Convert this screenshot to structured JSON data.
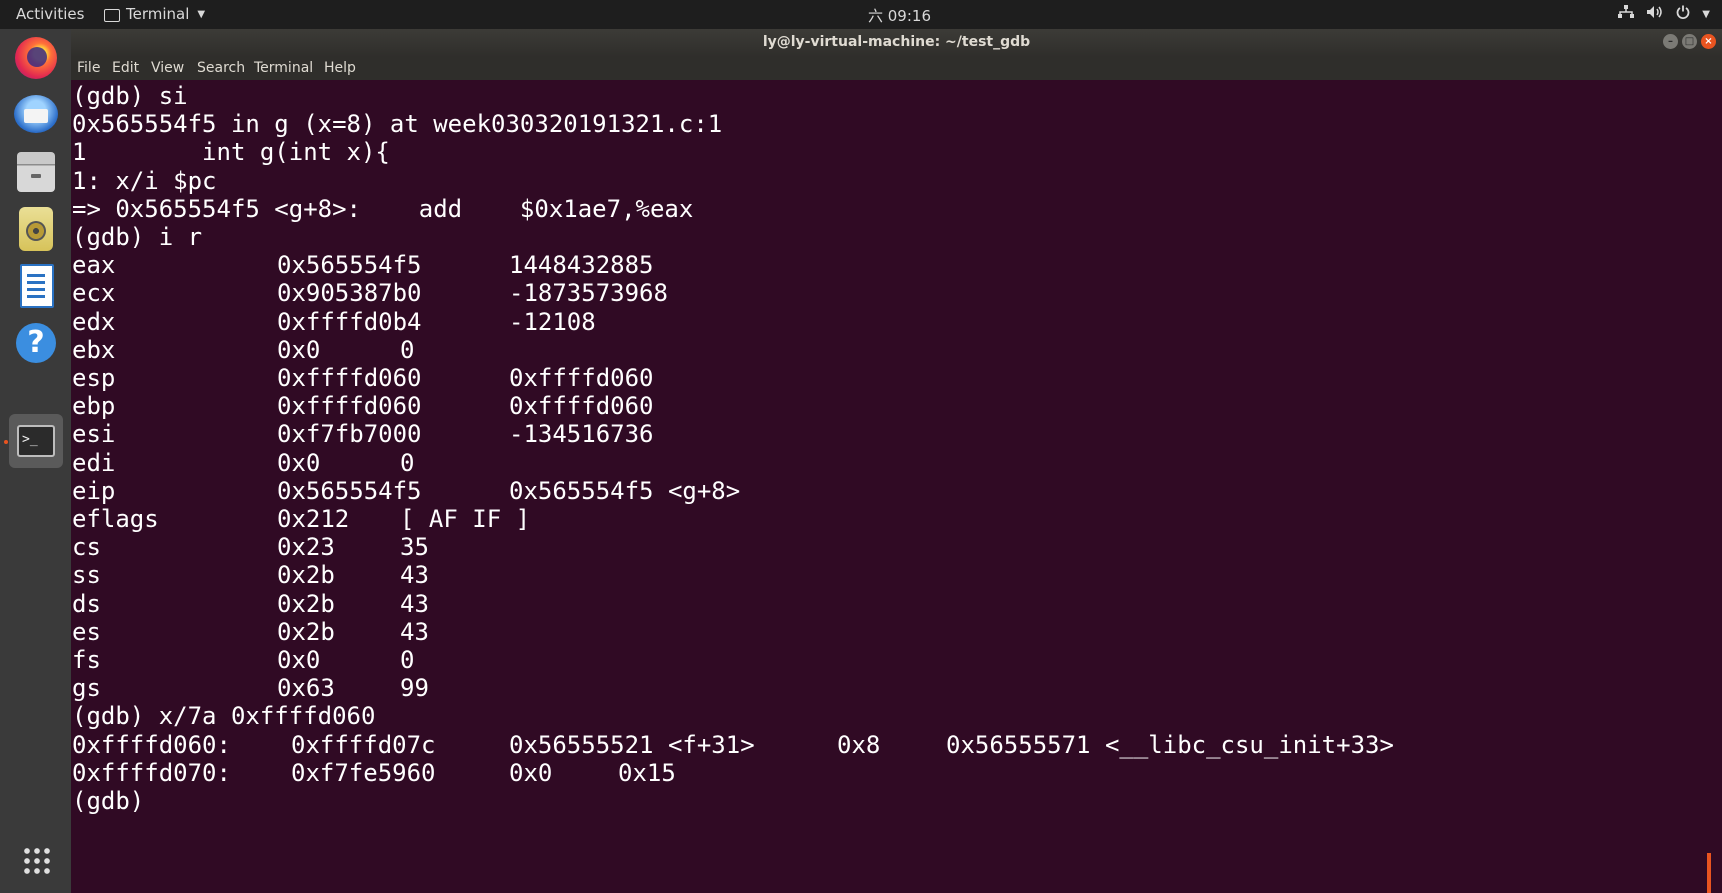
{
  "topbar": {
    "activities": "Activities",
    "app_name": "Terminal",
    "clock": "六 09:16"
  },
  "dock": {
    "items": [
      {
        "name": "firefox-icon"
      },
      {
        "name": "thunderbird-mail-icon"
      },
      {
        "name": "files-icon"
      },
      {
        "name": "rhythmbox-icon"
      },
      {
        "name": "libreoffice-writer-icon"
      },
      {
        "name": "help-icon"
      },
      {
        "name": "terminal-icon",
        "active": true
      }
    ],
    "terminal_glyph": ">_"
  },
  "window": {
    "title": "ly@ly-virtual-machine: ~/test_gdb",
    "menu": [
      "File",
      "Edit",
      "View",
      "Search",
      "Terminal",
      "Help"
    ]
  },
  "terminal": {
    "lines": [
      {
        "type": "text",
        "text": "(gdb) si"
      },
      {
        "type": "text",
        "text": "0x565554f5 in g (x=8) at week030320191321.c:1"
      },
      {
        "type": "text",
        "text": "1\t int g(int x){"
      },
      {
        "type": "text",
        "text": "1: x/i $pc"
      },
      {
        "type": "text",
        "text": "=> 0x565554f5 <g+8>:    add    $0x1ae7,%eax"
      },
      {
        "type": "text",
        "text": "(gdb) i r"
      },
      {
        "type": "reg",
        "name": "eax",
        "hex": "0x565554f5",
        "val": "1448432885"
      },
      {
        "type": "reg",
        "name": "ecx",
        "hex": "0x905387b0",
        "val": "-1873573968"
      },
      {
        "type": "reg",
        "name": "edx",
        "hex": "0xffffd0b4",
        "val": "-12108"
      },
      {
        "type": "reg",
        "name": "ebx",
        "hex": "0x0",
        "val": "0"
      },
      {
        "type": "reg",
        "name": "esp",
        "hex": "0xffffd060",
        "val": "0xffffd060"
      },
      {
        "type": "reg",
        "name": "ebp",
        "hex": "0xffffd060",
        "val": "0xffffd060"
      },
      {
        "type": "reg",
        "name": "esi",
        "hex": "0xf7fb7000",
        "val": "-134516736"
      },
      {
        "type": "reg",
        "name": "edi",
        "hex": "0x0",
        "val": "0"
      },
      {
        "type": "reg",
        "name": "eip",
        "hex": "0x565554f5",
        "val": "0x565554f5 <g+8>"
      },
      {
        "type": "reg",
        "name": "eflags",
        "hex": "0x212",
        "val": "[ AF IF ]"
      },
      {
        "type": "reg",
        "name": "cs",
        "hex": "0x23",
        "val": "35"
      },
      {
        "type": "reg",
        "name": "ss",
        "hex": "0x2b",
        "val": "43"
      },
      {
        "type": "reg",
        "name": "ds",
        "hex": "0x2b",
        "val": "43"
      },
      {
        "type": "reg",
        "name": "es",
        "hex": "0x2b",
        "val": "43"
      },
      {
        "type": "reg",
        "name": "fs",
        "hex": "0x0",
        "val": "0"
      },
      {
        "type": "reg",
        "name": "gs",
        "hex": "0x63",
        "val": "99"
      },
      {
        "type": "text",
        "text": "(gdb) x/7a 0xffffd060"
      },
      {
        "type": "mem",
        "addr": "0xffffd060:",
        "cells": [
          "0xffffd07c",
          "0x56555521 <f+31>",
          "0x8",
          "0x56555571 <__libc_csu_init+33>"
        ]
      },
      {
        "type": "mem",
        "addr": "0xffffd070:",
        "cells": [
          "0xf7fe5960",
          "0x0",
          "0x15"
        ]
      },
      {
        "type": "text",
        "text": "(gdb) "
      }
    ]
  }
}
